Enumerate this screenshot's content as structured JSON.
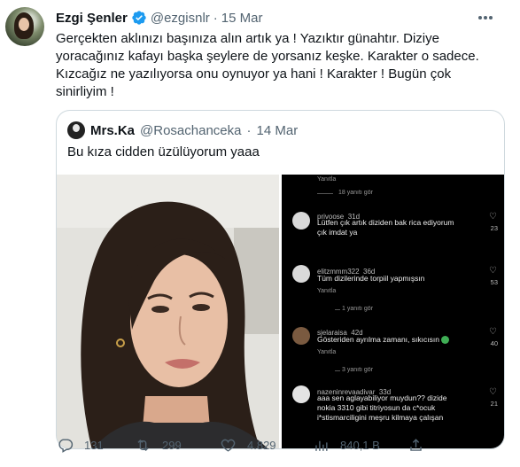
{
  "tweet": {
    "author_name": "Ezgi Şenler",
    "handle": "@ezgisnlr",
    "separator": "·",
    "date": "15 Mar",
    "text": "Gerçekten aklınızı başınıza alın artık ya ! Yazıktır günahtır. Diziye\nyoracağınız kafayı başka şeylere de yorsanız keşke. Karakter o sadece.\nKızcağız ne yazılıyorsa onu oynuyor ya hani ! Karakter ! Bugün çok\nsinirliyim !",
    "icons": {
      "verified": "verified-badge-icon",
      "more": "more-icon"
    },
    "colors": {
      "verified": "#1d9bf0",
      "secondary_text": "#536471"
    }
  },
  "quoted": {
    "author_name": "Mrs.Ka",
    "handle": "@Rosachanceka",
    "separator": "·",
    "date": "14 Mar",
    "text": "Bu kıza cidden üzülüyorum yaaa",
    "screenshot": {
      "top_reply": "Yanıtla",
      "sep1": "18 yanıtı gör",
      "comments": [
        {
          "user": "privoose",
          "age": "31d",
          "text": "Lütfen çık artık diziden bak rica ediyorum\nçık imdat ya",
          "reply": "Yanıtla",
          "likes": "23"
        },
        {
          "user": "elitzmmm322",
          "age": "36d",
          "text": "Tüm dizilerinde torpiil yapmışsın",
          "reply": "Yanıtla",
          "likes": "53"
        },
        {
          "user": "sjelaraisa",
          "age": "42d",
          "text": "Gösteriden ayrılma zamanı, sıkıcısın",
          "reply": "Yanıtla",
          "likes": "40"
        },
        {
          "user": "nazeninrevaadivar",
          "age": "33d",
          "text": "aaa sen aglayabiliyor muydun?? dizide\nnokia 3310 gibi titriyosun da c*ocuk\ni*stismarciligini meşru kilmaya çalışan",
          "reply": "",
          "likes": "21"
        }
      ],
      "sep2": "1 yanıtı gör",
      "sep3": "3 yanıtı gör"
    }
  },
  "actions": {
    "replies": "131",
    "retweets": "299",
    "likes": "4.829",
    "views": "840,1 B",
    "icons": [
      "reply-icon",
      "retweet-icon",
      "like-icon",
      "views-icon",
      "share-icon"
    ]
  }
}
